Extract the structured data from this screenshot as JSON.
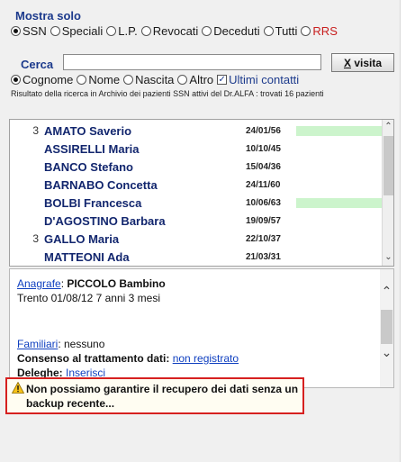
{
  "filter": {
    "label": "Mostra solo",
    "options": [
      {
        "label": "SSN",
        "selected": true
      },
      {
        "label": "Speciali",
        "selected": false
      },
      {
        "label": "L.P.",
        "selected": false
      },
      {
        "label": "Revocati",
        "selected": false
      },
      {
        "label": "Deceduti",
        "selected": false
      },
      {
        "label": "Tutti",
        "selected": false
      },
      {
        "label": "RRS",
        "selected": false
      }
    ]
  },
  "search": {
    "label": "Cerca",
    "value": "",
    "visit_button_accel": "X",
    "visit_button_rest": " visita",
    "modes": [
      {
        "label": "Cognome",
        "selected": true
      },
      {
        "label": "Nome",
        "selected": false
      },
      {
        "label": "Nascita",
        "selected": false
      },
      {
        "label": "Altro",
        "selected": false
      }
    ],
    "recent_checkbox_label": "Ultimi contatti",
    "recent_checked": true,
    "result_text": "Risultato della ricerca in Archivio dei pazienti SSN attivi del Dr.ALFA  : trovati 16 pazienti"
  },
  "patients": [
    {
      "count": "3",
      "name": "AMATO Saverio",
      "date": "24/01/56",
      "flagged": true
    },
    {
      "count": "",
      "name": "ASSIRELLI Maria",
      "date": "10/10/45",
      "flagged": false
    },
    {
      "count": "",
      "name": "BANCO Stefano",
      "date": "15/04/36",
      "flagged": false
    },
    {
      "count": "",
      "name": "BARNABO Concetta",
      "date": "24/11/60",
      "flagged": false
    },
    {
      "count": "",
      "name": "BOLBI Francesca",
      "date": "10/06/63",
      "flagged": true
    },
    {
      "count": "",
      "name": "D'AGOSTINO Barbara",
      "date": "19/09/57",
      "flagged": false
    },
    {
      "count": "3",
      "name": "GALLO Maria",
      "date": "22/10/37",
      "flagged": false
    },
    {
      "count": "",
      "name": "MATTEONI Ada",
      "date": "21/03/31",
      "flagged": false
    }
  ],
  "details": {
    "anagrafe_link": "Anagrafe",
    "anagrafe_sep": ": ",
    "patient_name": "PICCOLO Bambino",
    "birth_info": "Trento 01/08/12 7 anni 3 mesi",
    "familiari_link": "Familiari",
    "familiari_value": ": nessuno",
    "consenso_label": "Consenso al trattamento dati: ",
    "consenso_link": "non registrato",
    "deleghe_label": "Deleghe: ",
    "deleghe_link": "Inserisci"
  },
  "warning": {
    "icon": "warning-icon",
    "text": "Non possiamo garantire il recupero dei dati senza un backup recente..."
  },
  "colors": {
    "label_blue": "#1c3a8c",
    "link_blue": "#1040c0",
    "flag_green": "#ccf4cc",
    "warning_red": "#d62020"
  }
}
